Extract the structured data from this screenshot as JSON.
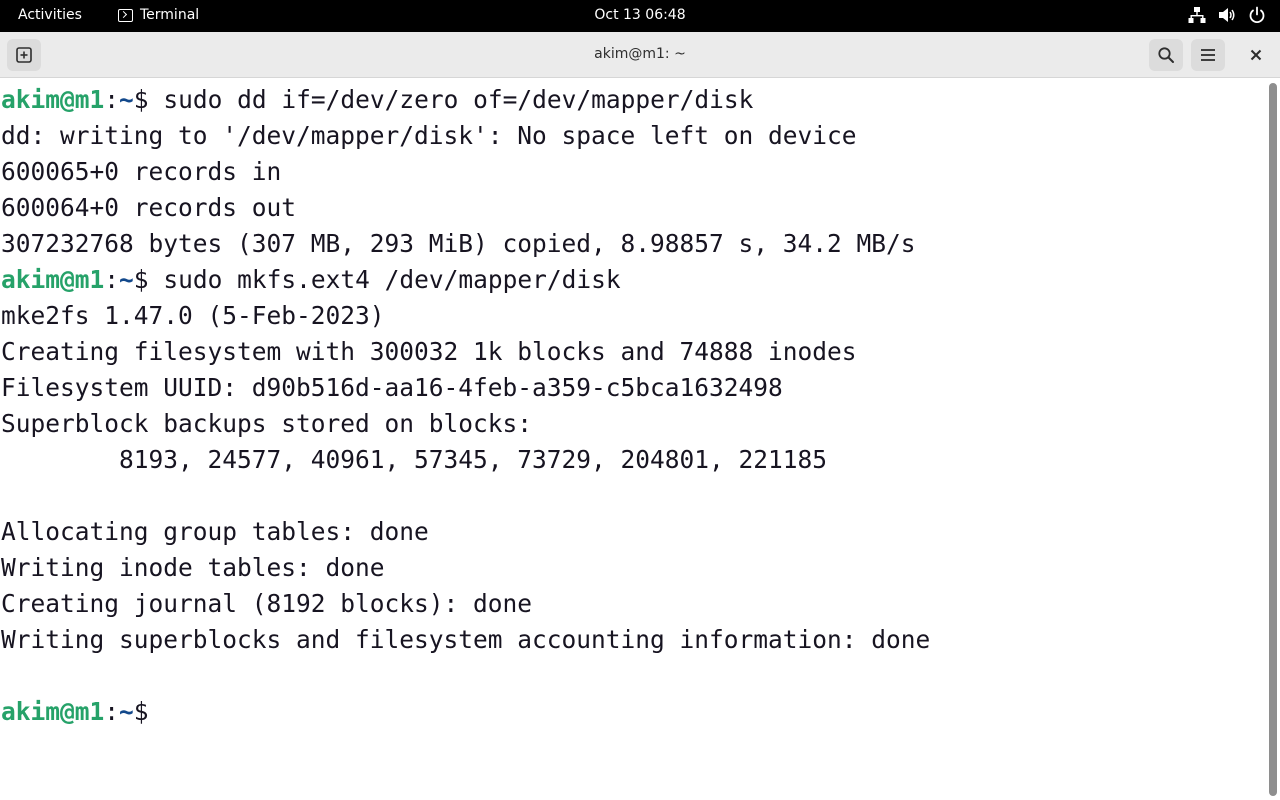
{
  "topbar": {
    "activities": "Activities",
    "app_name": "Terminal",
    "clock": "Oct 13  06:48",
    "icons": [
      "network-icon",
      "volume-icon",
      "power-icon"
    ]
  },
  "window": {
    "title": "akim@m1: ~"
  },
  "terminal": {
    "prompt_user": "akim@m1",
    "prompt_sep": ":",
    "prompt_path": "~",
    "prompt_symbol": "$",
    "lines": [
      {
        "type": "prompt",
        "command": " sudo dd if=/dev/zero of=/dev/mapper/disk"
      },
      {
        "type": "output",
        "text": "dd: writing to '/dev/mapper/disk': No space left on device"
      },
      {
        "type": "output",
        "text": "600065+0 records in"
      },
      {
        "type": "output",
        "text": "600064+0 records out"
      },
      {
        "type": "output",
        "text": "307232768 bytes (307 MB, 293 MiB) copied, 8.98857 s, 34.2 MB/s"
      },
      {
        "type": "prompt",
        "command": " sudo mkfs.ext4 /dev/mapper/disk"
      },
      {
        "type": "output",
        "text": "mke2fs 1.47.0 (5-Feb-2023)"
      },
      {
        "type": "output",
        "text": "Creating filesystem with 300032 1k blocks and 74888 inodes"
      },
      {
        "type": "output",
        "text": "Filesystem UUID: d90b516d-aa16-4feb-a359-c5bca1632498"
      },
      {
        "type": "output",
        "text": "Superblock backups stored on blocks:"
      },
      {
        "type": "output",
        "text": "        8193, 24577, 40961, 57345, 73729, 204801, 221185"
      },
      {
        "type": "output",
        "text": ""
      },
      {
        "type": "output",
        "text": "Allocating group tables: done"
      },
      {
        "type": "output",
        "text": "Writing inode tables: done"
      },
      {
        "type": "output",
        "text": "Creating journal (8192 blocks): done"
      },
      {
        "type": "output",
        "text": "Writing superblocks and filesystem accounting information: done"
      },
      {
        "type": "output",
        "text": ""
      },
      {
        "type": "prompt",
        "command": " "
      }
    ]
  }
}
